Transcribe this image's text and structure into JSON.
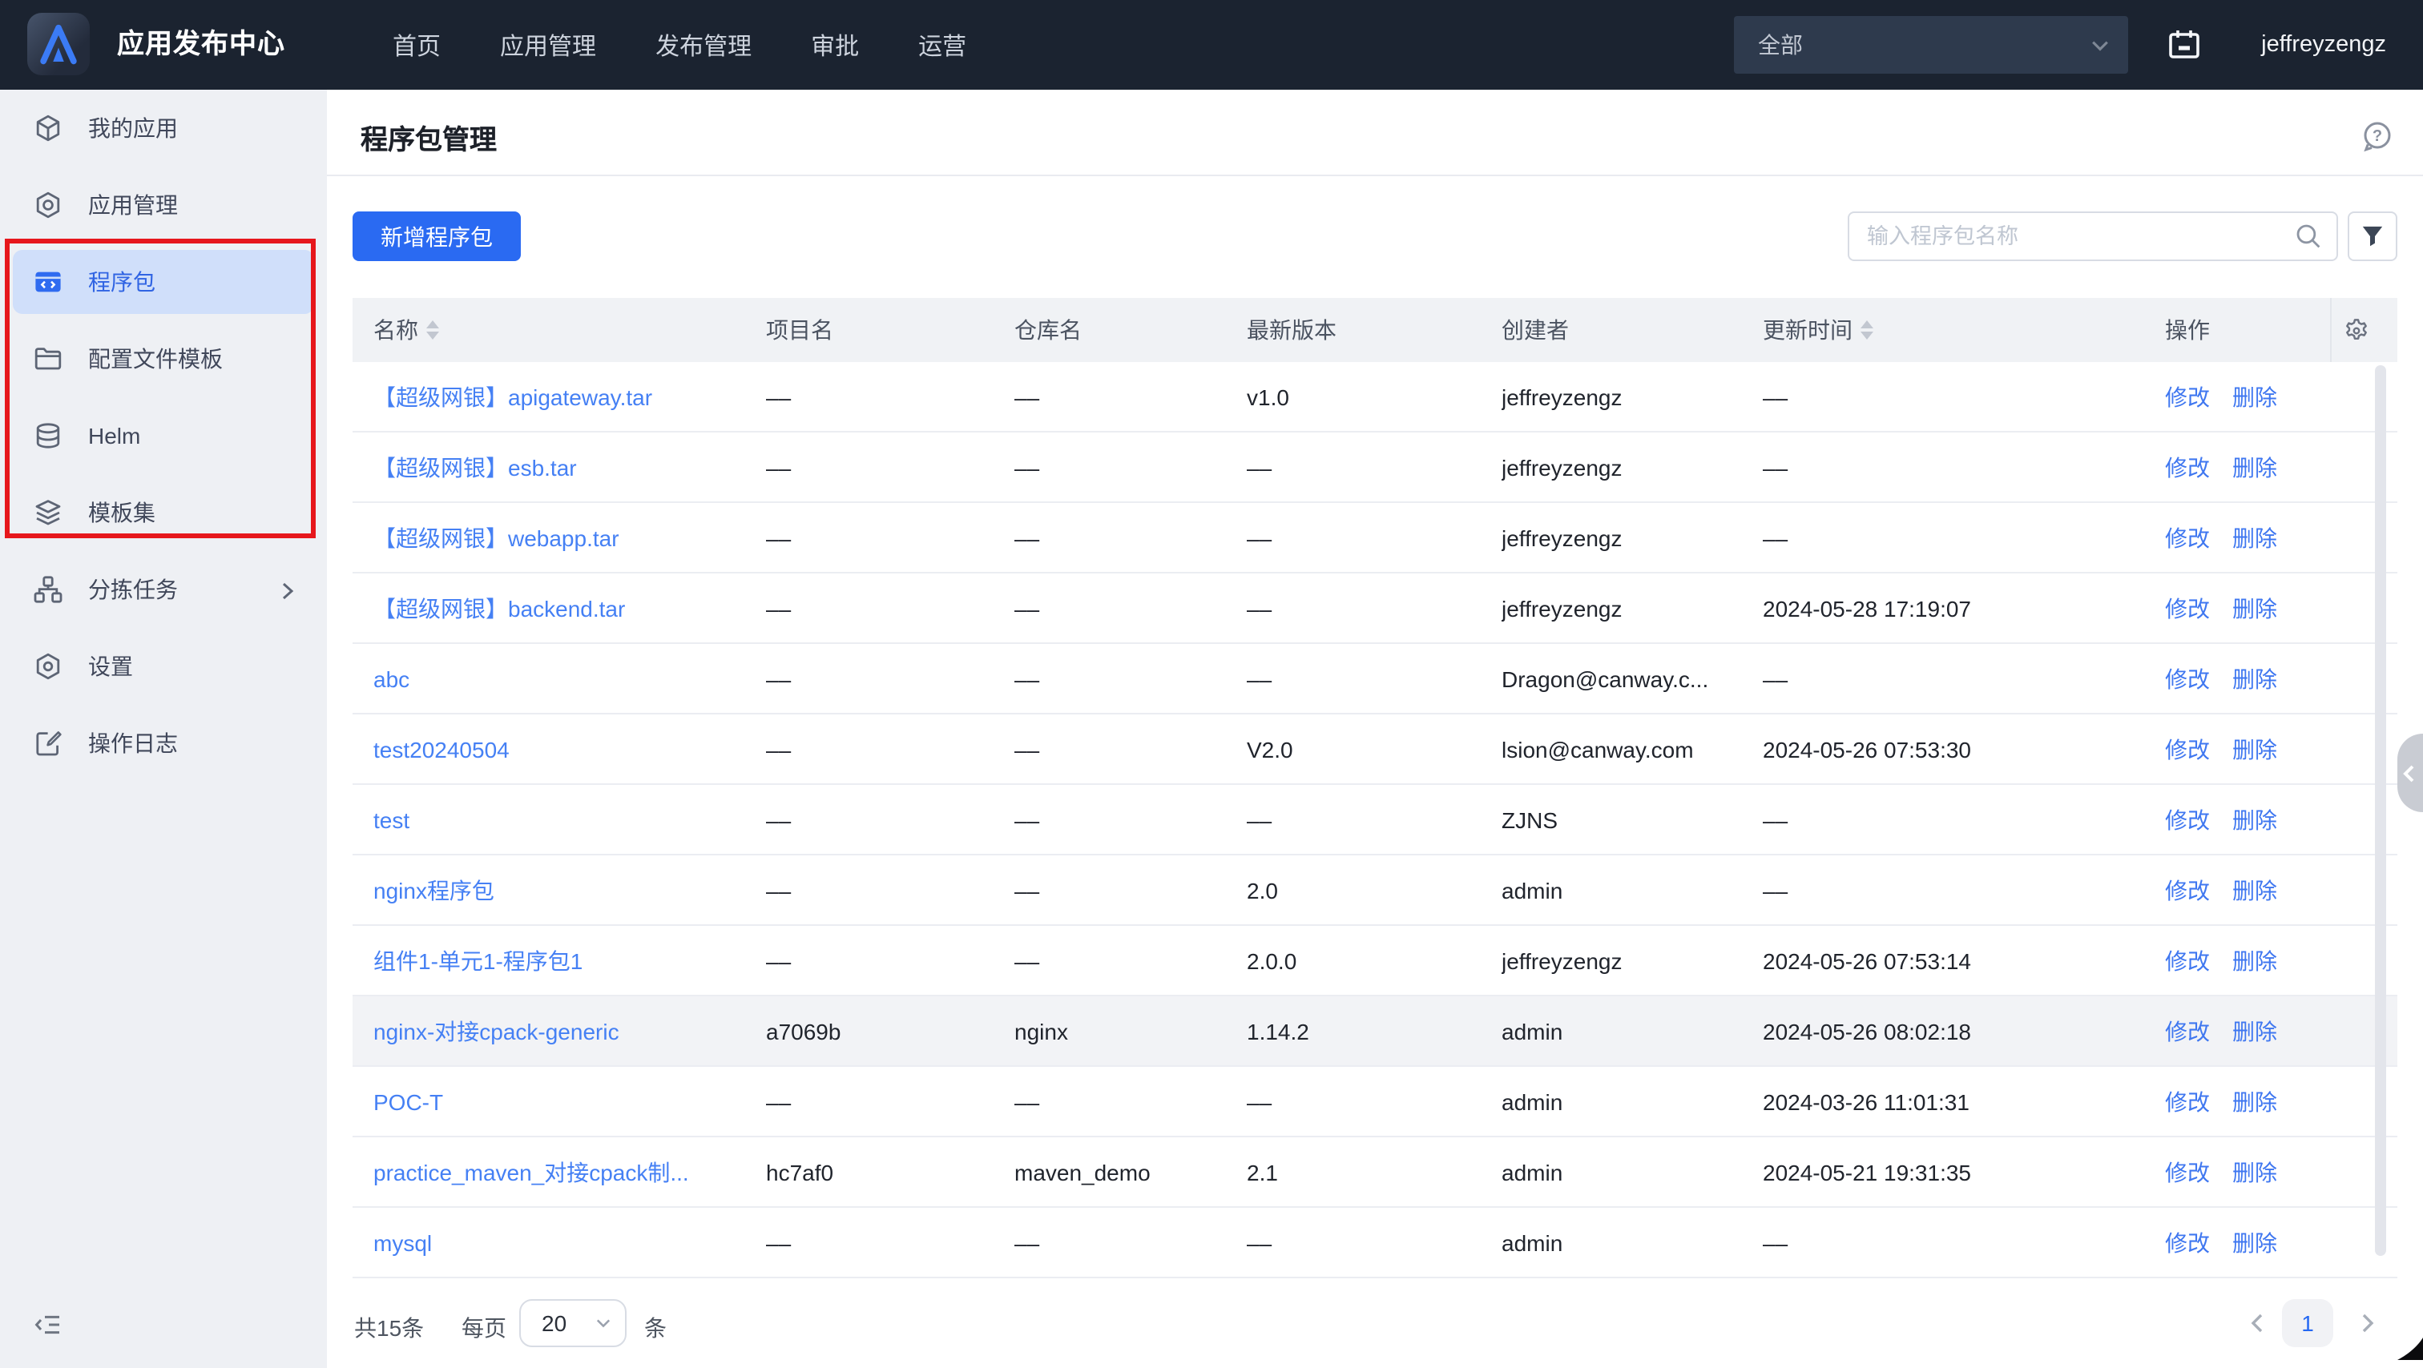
{
  "navbar": {
    "brand": "应用发布中心",
    "menu": [
      "首页",
      "应用管理",
      "发布管理",
      "审批",
      "运营"
    ],
    "scope_select_value": "全部",
    "username": "jeffreyzengz",
    "icons": [
      "app-logo",
      "journal-icon"
    ]
  },
  "sidebar": {
    "items": [
      {
        "label": "我的应用",
        "icon": "my-apps-icon",
        "active": false,
        "chevron": false
      },
      {
        "label": "应用管理",
        "icon": "app-manage-icon",
        "active": false,
        "chevron": false
      },
      {
        "label": "程序包",
        "icon": "package-icon",
        "active": true,
        "chevron": false
      },
      {
        "label": "配置文件模板",
        "icon": "folder-icon",
        "active": false,
        "chevron": false
      },
      {
        "label": "Helm",
        "icon": "database-icon",
        "active": false,
        "chevron": false
      },
      {
        "label": "模板集",
        "icon": "layers-icon",
        "active": false,
        "chevron": false
      },
      {
        "label": "分拣任务",
        "icon": "flow-icon",
        "active": false,
        "chevron": true
      },
      {
        "label": "设置",
        "icon": "settings-icon",
        "active": false,
        "chevron": false
      },
      {
        "label": "操作日志",
        "icon": "log-icon",
        "active": false,
        "chevron": false
      }
    ],
    "annotation": {
      "color": "#e6171c",
      "wraps": [
        "程序包",
        "配置文件模板",
        "Helm",
        "模板集"
      ]
    }
  },
  "page": {
    "title": "程序包管理",
    "add_button": "新增程序包",
    "search_placeholder": "输入程序包名称"
  },
  "table": {
    "columns": [
      {
        "label": "名称",
        "sortable": true
      },
      {
        "label": "项目名",
        "sortable": false
      },
      {
        "label": "仓库名",
        "sortable": false
      },
      {
        "label": "最新版本",
        "sortable": false
      },
      {
        "label": "创建者",
        "sortable": false
      },
      {
        "label": "更新时间",
        "sortable": true
      },
      {
        "label": "操作",
        "sortable": false
      }
    ],
    "action_labels": [
      "修改",
      "删除"
    ],
    "rows": [
      {
        "name": "【超级网银】apigateway.tar",
        "project": "––",
        "repo": "––",
        "version": "v1.0",
        "creator": "jeffreyzengz",
        "updated": "––",
        "hover": false
      },
      {
        "name": "【超级网银】esb.tar",
        "project": "––",
        "repo": "––",
        "version": "––",
        "creator": "jeffreyzengz",
        "updated": "––",
        "hover": false
      },
      {
        "name": "【超级网银】webapp.tar",
        "project": "––",
        "repo": "––",
        "version": "––",
        "creator": "jeffreyzengz",
        "updated": "––",
        "hover": false
      },
      {
        "name": "【超级网银】backend.tar",
        "project": "––",
        "repo": "––",
        "version": "––",
        "creator": "jeffreyzengz",
        "updated": "2024-05-28 17:19:07",
        "hover": false
      },
      {
        "name": "abc",
        "project": "––",
        "repo": "––",
        "version": "––",
        "creator": "Dragon@canway.c...",
        "updated": "––",
        "hover": false
      },
      {
        "name": "test20240504",
        "project": "––",
        "repo": "––",
        "version": "V2.0",
        "creator": "lsion@canway.com",
        "updated": "2024-05-26 07:53:30",
        "hover": false
      },
      {
        "name": "test",
        "project": "––",
        "repo": "––",
        "version": "––",
        "creator": "ZJNS",
        "updated": "––",
        "hover": false
      },
      {
        "name": "nginx程序包",
        "project": "––",
        "repo": "––",
        "version": "2.0",
        "creator": "admin",
        "updated": "––",
        "hover": false
      },
      {
        "name": "组件1-单元1-程序包1",
        "project": "––",
        "repo": "––",
        "version": "2.0.0",
        "creator": "jeffreyzengz",
        "updated": "2024-05-26 07:53:14",
        "hover": false
      },
      {
        "name": "nginx-对接cpack-generic",
        "project": "a7069b",
        "repo": "nginx",
        "version": "1.14.2",
        "creator": "admin",
        "updated": "2024-05-26 08:02:18",
        "hover": true
      },
      {
        "name": "POC-T",
        "project": "––",
        "repo": "––",
        "version": "––",
        "creator": "admin",
        "updated": "2024-03-26 11:01:31",
        "hover": false
      },
      {
        "name": "practice_maven_对接cpack制...",
        "project": "hc7af0",
        "repo": "maven_demo",
        "version": "2.1",
        "creator": "admin",
        "updated": "2024-05-21 19:31:35",
        "hover": false
      },
      {
        "name": "mysql",
        "project": "––",
        "repo": "––",
        "version": "––",
        "creator": "admin",
        "updated": "––",
        "hover": false
      }
    ]
  },
  "footer": {
    "total": "共15条",
    "per_page_label": "每页",
    "page_size": "20",
    "unit": "条",
    "current_page": "1"
  }
}
